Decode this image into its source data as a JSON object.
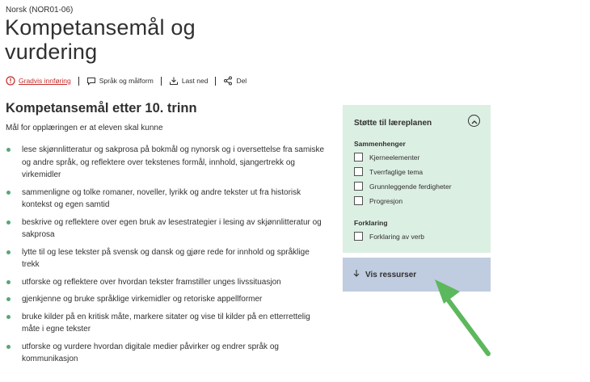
{
  "header": {
    "subject": "Norsk (NOR01-06)",
    "title_line1": "Kompetansemål og",
    "title_line2": "vurdering"
  },
  "toolbar": {
    "items": [
      {
        "label": "Gradvis innføring",
        "icon": "info-circle-icon"
      },
      {
        "label": "Språk og målform",
        "icon": "speech-bubble-icon"
      },
      {
        "label": "Last ned",
        "icon": "download-icon"
      },
      {
        "label": "Del",
        "icon": "share-icon"
      }
    ]
  },
  "main": {
    "section_title": "Kompetansemål etter 10. trinn",
    "intro": "Mål for opplæringen er at eleven skal kunne",
    "goals": [
      "lese skjønnlitteratur og sakprosa på bokmål og nynorsk og i oversettelse fra samiske og andre språk, og reflektere over tekstenes formål, innhold, sjangertrekk og virkemidler",
      "sammenligne og tolke romaner, noveller, lyrikk og andre tekster ut fra historisk kontekst og egen samtid",
      "beskrive og reflektere over egen bruk av lesestrategier i lesing av skjønnlitteratur og sakprosa",
      "lytte til og lese tekster på svensk og dansk og gjøre rede for innhold og språklige trekk",
      "utforske og reflektere over hvordan tekster framstiller unges livssituasjon",
      "gjenkjenne og bruke språklige virkemidler og retoriske appellformer",
      "bruke kilder på en kritisk måte, markere sitater og vise til kilder på en etterrettelig måte i egne tekster",
      "utforske og vurdere hvordan digitale medier påvirker og endrer språk og kommunikasjon"
    ]
  },
  "side_panel": {
    "title": "Støtte til læreplanen",
    "groups": [
      {
        "label": "Sammenhenger",
        "options": [
          "Kjerneelementer",
          "Tverrfaglige tema",
          "Grunnleggende ferdigheter",
          "Progresjon"
        ]
      },
      {
        "label": "Forklaring",
        "options": [
          "Forklaring av verb"
        ]
      }
    ],
    "resources_label": "Vis ressurser"
  },
  "colors": {
    "accent_red": "#c42b2b",
    "bullet_green": "#58a67b",
    "panel_green": "#dcefe3",
    "panel_blue": "#c0cce0",
    "arrow_green": "#5cb85c"
  }
}
